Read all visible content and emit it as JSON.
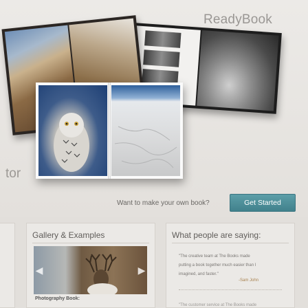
{
  "brand": {
    "name": "ReadyBook"
  },
  "hero": {
    "side_text": "tor"
  },
  "cta": {
    "prompt": "Want to make your own book?",
    "button_label": "Get Started"
  },
  "gallery": {
    "title": "Gallery & Examples",
    "caption": "Photography Book:"
  },
  "testimonials": {
    "title": "What people are saying:",
    "quote_line_1": "\"The creative team at The Books made",
    "quote_line_2": "putting a book together much easier than I",
    "quote_line_3": "imagined, and faster.\"",
    "author": "-Sam John",
    "cut_off_line": "\"The customer service at The Books made"
  },
  "colors": {
    "accent": "#4a8d97",
    "author": "#a8824f",
    "background": "#e6e3df"
  },
  "icons": [
    "chevron-left-icon",
    "chevron-right-icon"
  ]
}
